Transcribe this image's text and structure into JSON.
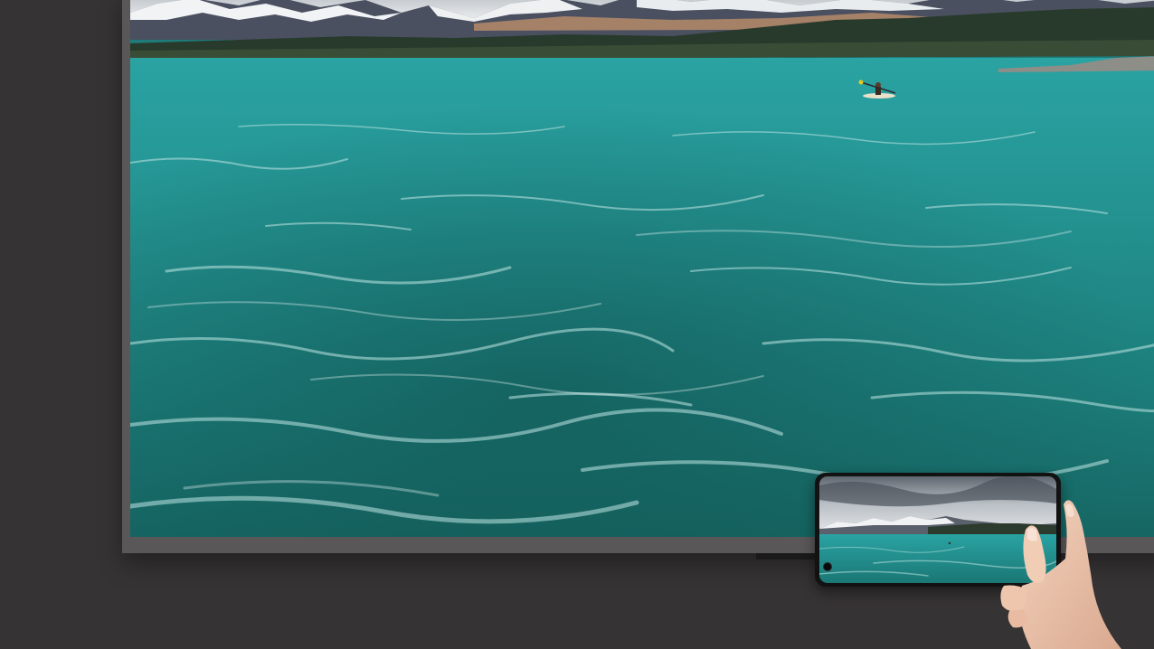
{
  "scene": {
    "description_label": "",
    "colors": {
      "background": "#363334",
      "tv_frame": "#5a5758",
      "lake": "#1f7a7a",
      "sky": "#d8dde2",
      "phone_body": "#121212"
    },
    "icons": [
      "tv-screen",
      "phone-screen",
      "hand-icon",
      "kayak-icon"
    ]
  }
}
